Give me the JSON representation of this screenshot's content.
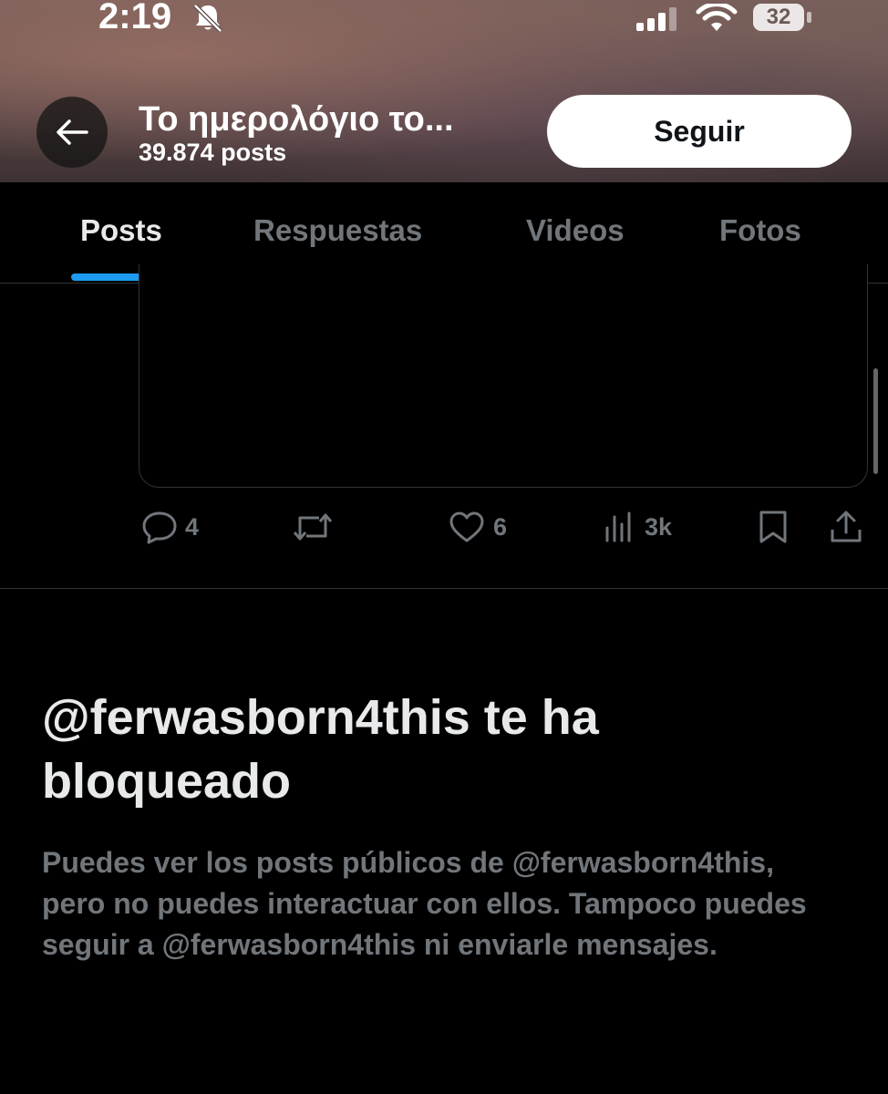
{
  "status_bar": {
    "time": "2:19",
    "battery": "32"
  },
  "header": {
    "title": "Το ημερολόγιο το...",
    "post_count": "39.874 posts",
    "follow_label": "Seguir"
  },
  "tabs": [
    {
      "label": "Posts",
      "active": true
    },
    {
      "label": "Respuestas",
      "active": false
    },
    {
      "label": "Videos",
      "active": false
    },
    {
      "label": "Fotos",
      "active": false
    }
  ],
  "post_actions": {
    "replies": "4",
    "likes": "6",
    "views": "3k"
  },
  "blocked": {
    "title": "@ferwasborn4this te ha bloqueado",
    "body": "Puedes ver los posts públicos de @ferwasborn4this, pero no puedes interactuar con ellos. Tampoco puedes seguir a @ferwasborn4this ni enviarle mensajes."
  },
  "colors": {
    "accent": "#1d9bf0",
    "muted": "#71767b",
    "background": "#000000"
  }
}
